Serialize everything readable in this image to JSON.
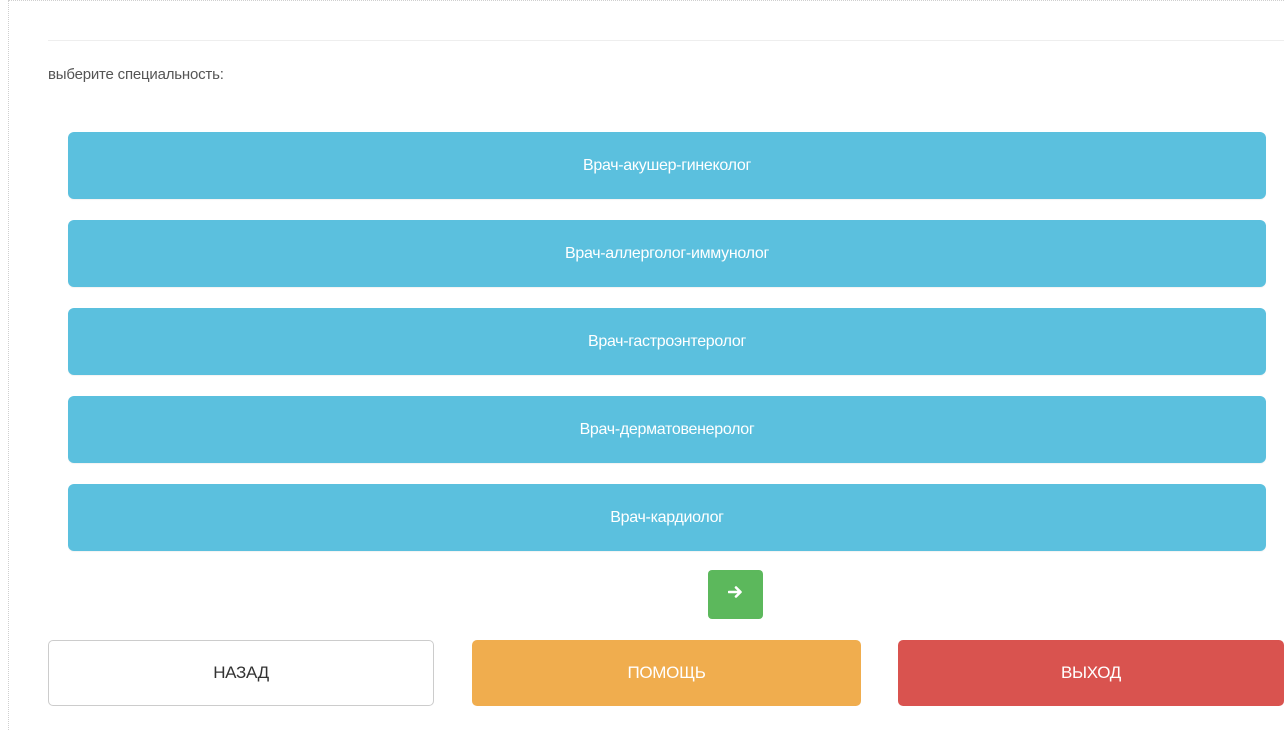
{
  "prompt": "выберите специальность:",
  "specialties": [
    "Врач-акушер-гинеколог",
    "Врач-аллерголог-иммунолог",
    "Врач-гастроэнтеролог",
    "Врач-дерматовенеролог",
    "Врач-кардиолог"
  ],
  "next_button": {
    "icon": "arrow-right-icon"
  },
  "actions": {
    "back_label": "НАЗАД",
    "help_label": "ПОМОЩЬ",
    "exit_label": "ВЫХОД"
  },
  "colors": {
    "specialty_button": "#5bc0de",
    "next_button": "#5cb85c",
    "help_button": "#f0ad4e",
    "exit_button": "#d9534f",
    "back_button": "#ffffff"
  }
}
